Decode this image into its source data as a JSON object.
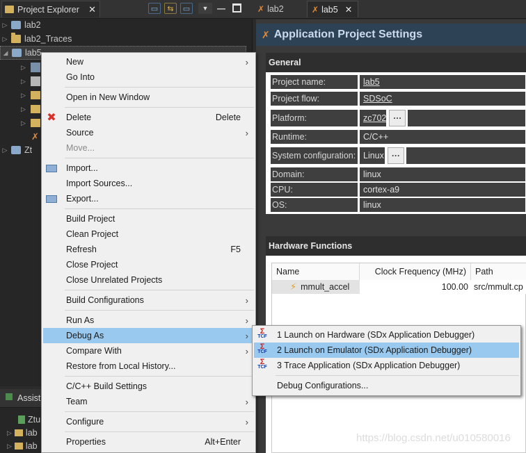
{
  "project_explorer": {
    "tab_label": "Project Explorer",
    "close": "✕",
    "tree": [
      {
        "label": "lab2"
      },
      {
        "label": "lab2_Traces"
      },
      {
        "label": "lab5"
      }
    ],
    "partial_item": "Zt"
  },
  "assistant": {
    "tab_label": "Assist",
    "items": [
      "Ztu",
      "lab",
      "lab"
    ]
  },
  "editor": {
    "tabs": [
      {
        "label": "lab2"
      },
      {
        "label": "lab5",
        "close": "✕"
      }
    ],
    "title": "Application Project Settings",
    "general": {
      "header": "General",
      "rows": [
        {
          "label": "Project name:",
          "value": "lab5"
        },
        {
          "label": "Project flow:",
          "value": "SDSoC"
        },
        {
          "label": "Platform:",
          "value": "zc702",
          "button": "···"
        },
        {
          "label": "Runtime:",
          "value": "C/C++"
        },
        {
          "label": "System configuration:",
          "value": "Linux",
          "button": "···"
        },
        {
          "label": "Domain:",
          "value": "linux"
        },
        {
          "label": "CPU:",
          "value": "cortex-a9"
        },
        {
          "label": "OS:",
          "value": "linux"
        }
      ]
    },
    "hardware_functions": {
      "header": "Hardware Functions",
      "columns": [
        "Name",
        "Clock Frequency (MHz)",
        "Path"
      ],
      "rows": [
        {
          "name": "mmult_accel",
          "clock": "100.00",
          "path": "src/mmult.cp"
        }
      ]
    }
  },
  "context_menu": {
    "items": [
      {
        "label": "New"
      },
      {
        "label": "Go Into"
      },
      {
        "label": "Open in New Window"
      },
      {
        "label": "Delete",
        "accel": "Delete"
      },
      {
        "label": "Source"
      },
      {
        "label": "Move..."
      },
      {
        "label": "Import..."
      },
      {
        "label": "Import Sources..."
      },
      {
        "label": "Export..."
      },
      {
        "label": "Build Project"
      },
      {
        "label": "Clean Project"
      },
      {
        "label": "Refresh",
        "accel": "F5"
      },
      {
        "label": "Close Project"
      },
      {
        "label": "Close Unrelated Projects"
      },
      {
        "label": "Build Configurations"
      },
      {
        "label": "Run As"
      },
      {
        "label": "Debug As"
      },
      {
        "label": "Compare With"
      },
      {
        "label": "Restore from Local History..."
      },
      {
        "label": "C/C++ Build Settings"
      },
      {
        "label": "Team"
      },
      {
        "label": "Configure"
      },
      {
        "label": "Properties",
        "accel": "Alt+Enter"
      }
    ]
  },
  "debug_submenu": {
    "items": [
      {
        "label": "1 Launch on Hardware (SDx Application Debugger)"
      },
      {
        "label": "2 Launch on Emulator (SDx Application Debugger)"
      },
      {
        "label": "3 Trace Application (SDx Application Debugger)"
      },
      {
        "label": "Debug Configurations..."
      }
    ]
  },
  "watermark": "https://blog.csdn.net/u010580016",
  "colors": {
    "menu_highlight": "#99c9ef",
    "title_bar": "#2e4256",
    "delete_icon": "#d9302c"
  }
}
